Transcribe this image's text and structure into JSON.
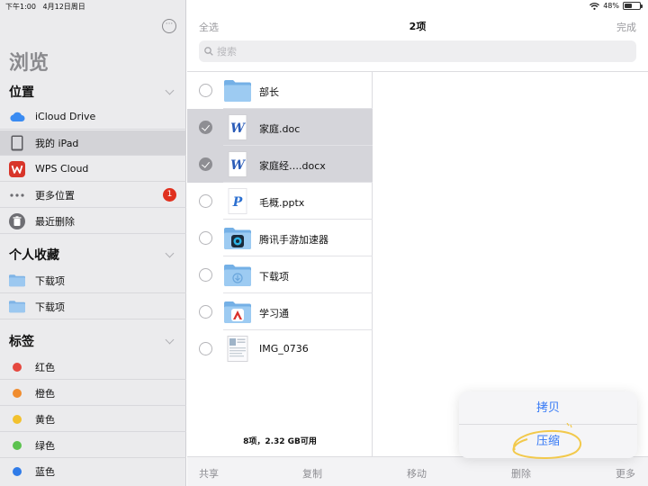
{
  "status_bar": {
    "time": "下午1:00",
    "date": "4月12日周日",
    "battery": "48%",
    "battery_level": 0.48
  },
  "sidebar": {
    "title": "浏览",
    "sections": {
      "locations": "位置",
      "favorites": "个人收藏",
      "tags": "标签"
    },
    "locations": [
      {
        "label": "iCloud Drive",
        "icon": "icloud-icon"
      },
      {
        "label": "我的 iPad",
        "icon": "ipad-icon",
        "selected": true
      },
      {
        "label": "WPS Cloud",
        "icon": "wps-icon"
      },
      {
        "label": "更多位置",
        "icon": "more-dots-icon",
        "badge": "1"
      },
      {
        "label": "最近删除",
        "icon": "trash-icon"
      }
    ],
    "favorites": [
      {
        "label": "下载项",
        "icon": "folder-icon"
      },
      {
        "label": "下载项",
        "icon": "folder-icon"
      }
    ],
    "tags": [
      {
        "label": "红色",
        "color": "#e5483f"
      },
      {
        "label": "橙色",
        "color": "#f08c2e"
      },
      {
        "label": "黄色",
        "color": "#f2c12e"
      },
      {
        "label": "绿色",
        "color": "#5cc24f"
      },
      {
        "label": "蓝色",
        "color": "#2f7be8"
      }
    ]
  },
  "header": {
    "select_all": "全选",
    "count": "2项",
    "done": "完成",
    "search_placeholder": "搜索"
  },
  "files": [
    {
      "name": "部长",
      "type": "folder",
      "selected": false
    },
    {
      "name": "家庭.doc",
      "type": "word",
      "selected": true
    },
    {
      "name": "家庭经….docx",
      "type": "word",
      "selected": true
    },
    {
      "name": "毛概.pptx",
      "type": "ppt",
      "selected": false
    },
    {
      "name": "腾讯手游加速器",
      "type": "folder-app",
      "selected": false
    },
    {
      "name": "下载项",
      "type": "folder-download",
      "selected": false
    },
    {
      "name": "学习通",
      "type": "folder-app2",
      "selected": false
    },
    {
      "name": "IMG_0736",
      "type": "image",
      "selected": false
    }
  ],
  "footer_info": "8项，2.32 GB可用",
  "toolbar": {
    "share": "共享",
    "copy": "复制",
    "move": "移动",
    "delete": "删除",
    "more": "更多"
  },
  "popover": {
    "duplicate": "拷贝",
    "compress": "压缩"
  },
  "colors": {
    "accent": "#3478f6",
    "badge": "#e0301e",
    "sidebar_bg": "#ebebed",
    "selected_row": "#d5d5da"
  }
}
